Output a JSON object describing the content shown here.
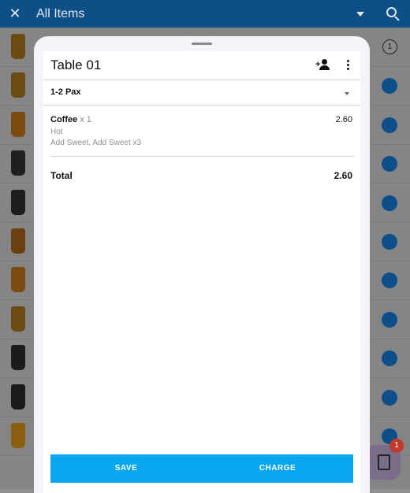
{
  "appbar": {
    "title": "All Items",
    "close_icon": "close-icon",
    "dropdown_icon": "caret-down-icon",
    "search_icon": "search-icon",
    "color": "#0d4f86"
  },
  "background_list": {
    "rows": [
      {
        "thumb": "#6b4a14",
        "button": "count",
        "count": "1"
      },
      {
        "thumb": "#6b4a14",
        "button": "add"
      },
      {
        "thumb": "#7a4a10",
        "button": "add"
      },
      {
        "thumb": "#202020",
        "button": "add"
      },
      {
        "thumb": "#1d1d1d",
        "button": "add"
      },
      {
        "thumb": "#6a4010",
        "button": "add"
      },
      {
        "thumb": "#7a4c12",
        "button": "add"
      },
      {
        "thumb": "#6b4a14",
        "button": "add"
      },
      {
        "thumb": "#1c1c1c",
        "button": "add"
      },
      {
        "thumb": "#1a1a1a",
        "button": "add"
      },
      {
        "thumb": "#8a6010",
        "button": "add"
      }
    ]
  },
  "fab": {
    "icon": "receipt-icon",
    "badge": "1"
  },
  "sheet": {
    "title": "Table 01",
    "add_customer_icon": "add-person-icon",
    "more_icon": "more-vert-icon",
    "pax": "1-2 Pax",
    "items": [
      {
        "name": "Coffee",
        "qty": "x 1",
        "price": "2.60",
        "modifiers": [
          "Hot",
          "Add Sweet, Add Sweet x3"
        ]
      }
    ],
    "total_label": "Total",
    "total_value": "2.60",
    "save_label": "SAVE",
    "charge_label": "CHARGE",
    "accent": "#06a6f0"
  }
}
